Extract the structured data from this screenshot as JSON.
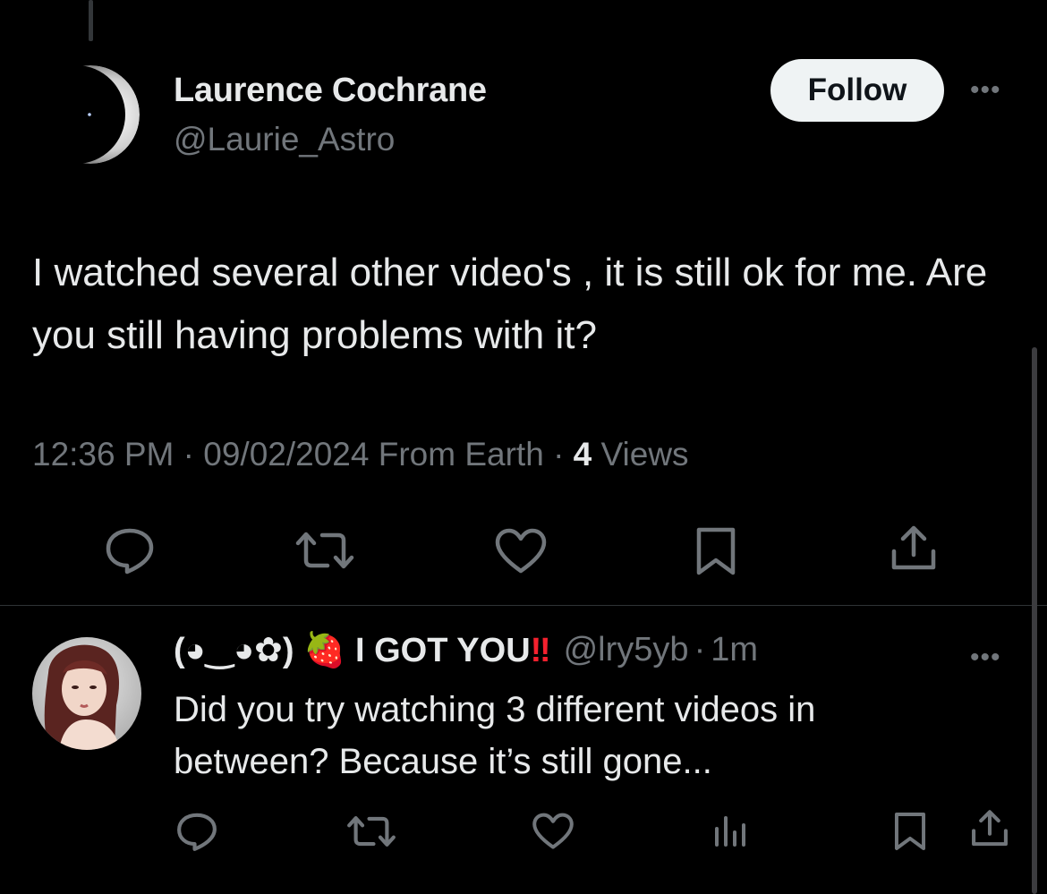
{
  "tweet": {
    "author_name": "Laurence Cochrane",
    "author_handle": "@Laurie_Astro",
    "follow_label": "Follow",
    "more_label": "•••",
    "text": "I watched several other video's , it is still ok for me. Are you still having problems with it?",
    "time": "12:36 PM",
    "date": "09/02/2024",
    "source": "From Earth",
    "separator": "·",
    "views_count": "4",
    "views_label": "Views",
    "actions": [
      "reply-icon",
      "retweet-icon",
      "like-icon",
      "bookmark-icon",
      "share-icon"
    ]
  },
  "reply": {
    "name_prefix": "(◕‿◕✿)",
    "strawberry": "🍓",
    "name_main": "I GOT YOU",
    "name_bangs": "‼",
    "handle": "@lry5yb",
    "separator": "·",
    "time": "1m",
    "more_label": "•••",
    "text": "Did you try watching 3 different videos in between? Because it’s still gone...",
    "actions": [
      "reply-icon",
      "retweet-icon",
      "like-icon",
      "analytics-icon",
      "bookmark-icon",
      "share-icon"
    ]
  },
  "colors": {
    "background": "#000000",
    "text_primary": "#e7e9ea",
    "text_secondary": "#71767b",
    "divider": "#2f3336",
    "follow_bg": "#eff3f4",
    "accent_red": "#f4212e"
  }
}
